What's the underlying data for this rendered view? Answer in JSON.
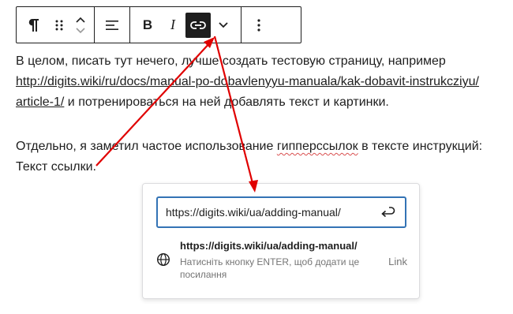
{
  "toolbar": {
    "paragraph_icon": "paragraph-icon",
    "drag_icon": "drag-handle-icon",
    "move_up_icon": "chevron-up-icon",
    "move_down_icon": "chevron-down-icon",
    "align_icon": "align-left-icon",
    "bold_label": "B",
    "italic_label": "I",
    "link_icon": "link-icon",
    "more_icon": "chevron-down-icon",
    "options_icon": "vertical-ellipsis-icon"
  },
  "content": {
    "p1_before": "В целом, писать тут нечего, лучше создать тестовую страницу, например",
    "p1_link_line1": "http://digits.wiki/ru/docs/manual-po-dobavlenyyu-manuala/kak-dobavit-instrukcziyu/",
    "p1_link_line2": "article-1/",
    "p1_after": " и потренироваться на ней добавлять текст и картинки.",
    "p2_before": "Отдельно, я заметил частое использование ",
    "p2_misspelled": "гипперссылок",
    "p2_after": " в тексте инструкций:",
    "p3": "Текст ссылки."
  },
  "link_popover": {
    "url_value": "https://digits.wiki/ua/adding-manual/",
    "submit_icon": "enter-return-icon",
    "suggestion_icon": "globe-icon",
    "suggestion_title": "https://digits.wiki/ua/adding-manual/",
    "suggestion_hint_line1": "Натисніть кнопку ENTER, щоб додати це",
    "suggestion_hint_line2": "посилання",
    "suggestion_type": "Link"
  },
  "colors": {
    "annotation_arrow": "#e00000",
    "focus_border": "#3373b5",
    "active_button": "#1e1e1e"
  }
}
